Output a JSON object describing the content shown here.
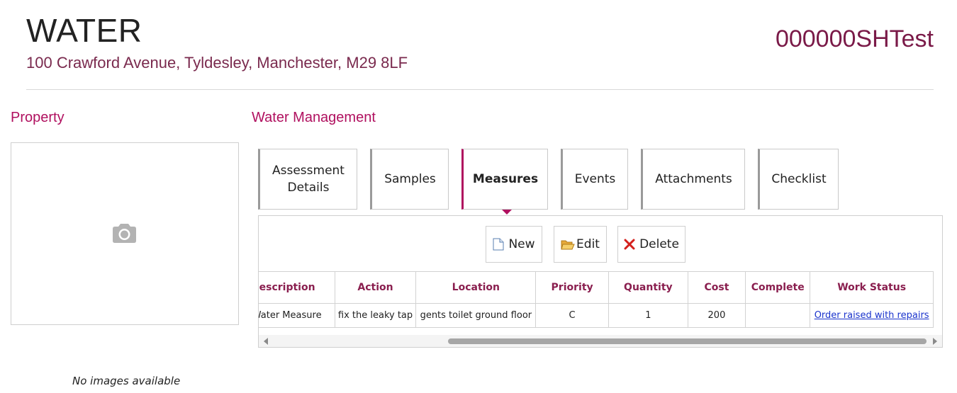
{
  "header": {
    "title": "WATER",
    "address": "100 Crawford Avenue, Tyldesley, Manchester, M29 8LF",
    "code": "000000SHTest"
  },
  "property": {
    "heading": "Property",
    "no_images": "No images available",
    "placeholder_icon": "camera-icon"
  },
  "water_management": {
    "heading": "Water Management",
    "tabs": [
      {
        "label": "Assessment Details",
        "active": false
      },
      {
        "label": "Samples",
        "active": false
      },
      {
        "label": "Measures",
        "active": true
      },
      {
        "label": "Events",
        "active": false
      },
      {
        "label": "Attachments",
        "active": false
      },
      {
        "label": "Checklist",
        "active": false
      }
    ],
    "toolbar": {
      "new_label": "New",
      "edit_label": "Edit",
      "delete_label": "Delete"
    },
    "table": {
      "columns": [
        "Description",
        "Action",
        "Location",
        "Priority",
        "Quantity",
        "Cost",
        "Complete",
        "Work Status"
      ],
      "rows": [
        {
          "description": "Water Measure",
          "action": "fix the leaky tap",
          "location": "gents toilet ground floor",
          "priority": "C",
          "quantity": "1",
          "cost": "200",
          "complete": "",
          "work_status": "Order raised with repairs"
        }
      ]
    }
  },
  "colors": {
    "accent": "#b0105f",
    "header_text": "#8a1f4f",
    "address_text": "#7a2a4e",
    "link": "#1a33cc"
  }
}
